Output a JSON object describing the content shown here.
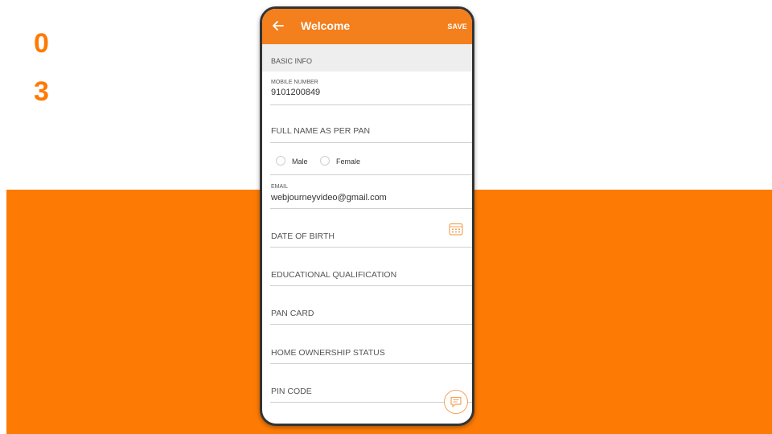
{
  "slide": {
    "step_digits": [
      "0",
      "3"
    ]
  },
  "colors": {
    "accent": "#fd7b05",
    "appbar": "#f37f1d",
    "section_bg": "#eeeeee"
  },
  "appbar": {
    "title": "Welcome",
    "save_label": "SAVE"
  },
  "form": {
    "section_title": "BASIC INFO",
    "mobile": {
      "label": "MOBILE NUMBER",
      "value": "9101200849"
    },
    "full_name": {
      "placeholder": "FULL NAME AS PER PAN"
    },
    "gender": {
      "options": [
        "Male",
        "Female"
      ]
    },
    "email": {
      "label": "EMAIL",
      "value": "webjourneyvideo@gmail.com"
    },
    "dob": {
      "placeholder": "DATE OF BIRTH"
    },
    "education": {
      "placeholder": "EDUCATIONAL QUALIFICATION"
    },
    "pan": {
      "placeholder": "PAN CARD"
    },
    "home": {
      "placeholder": "HOME OWNERSHIP STATUS"
    },
    "pin": {
      "placeholder": "PIN CODE"
    }
  },
  "icons": [
    "back-arrow-icon",
    "calendar-icon",
    "chat-icon"
  ]
}
